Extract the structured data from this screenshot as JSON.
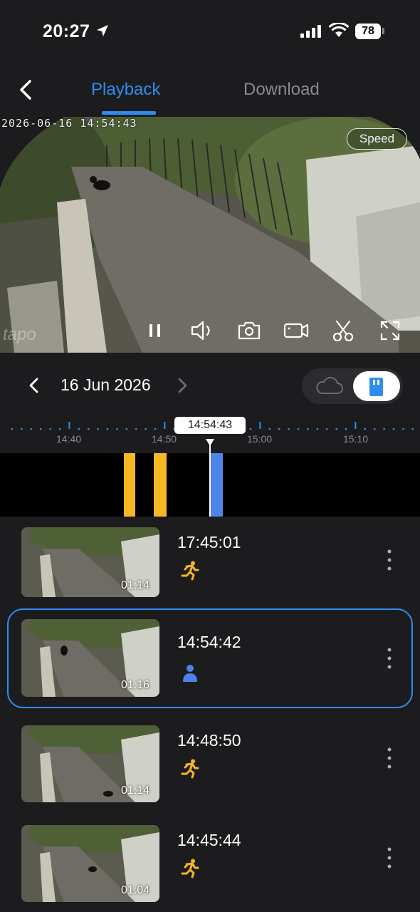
{
  "status_bar": {
    "time": "20:27",
    "battery": "78"
  },
  "nav": {
    "tabs": [
      {
        "label": "Playback",
        "active": true
      },
      {
        "label": "Download",
        "active": false
      }
    ]
  },
  "player": {
    "osd_timestamp": "2026-06-16 14:54:43",
    "speed_label": "Speed",
    "watermark": "tapo",
    "controls": [
      "pause-icon",
      "volume-icon",
      "snapshot-icon",
      "record-icon",
      "clip-icon",
      "fullscreen-icon"
    ]
  },
  "date_row": {
    "date": "16 Jun 2026",
    "storage_selected": "sd-card"
  },
  "timeline": {
    "current_time": "14:54:43",
    "tick_labels": [
      "14:40",
      "14:50",
      "15:00",
      "15:10"
    ],
    "events": [
      {
        "type": "motion",
        "color": "#f5b722"
      },
      {
        "type": "motion",
        "color": "#f5b722"
      },
      {
        "type": "person",
        "color": "#4a86e8"
      }
    ]
  },
  "clips": [
    {
      "time": "17:45:01",
      "duration": "01:14",
      "event": "motion",
      "selected": false
    },
    {
      "time": "14:54:42",
      "duration": "01:16",
      "event": "person",
      "selected": true
    },
    {
      "time": "14:48:50",
      "duration": "01:14",
      "event": "motion",
      "selected": false
    },
    {
      "time": "14:45:44",
      "duration": "01:04",
      "event": "motion",
      "selected": false
    }
  ],
  "colors": {
    "accent": "#2f8df0",
    "motion": "#f5b722",
    "person": "#4a86e8",
    "background": "#1c1c1e"
  }
}
